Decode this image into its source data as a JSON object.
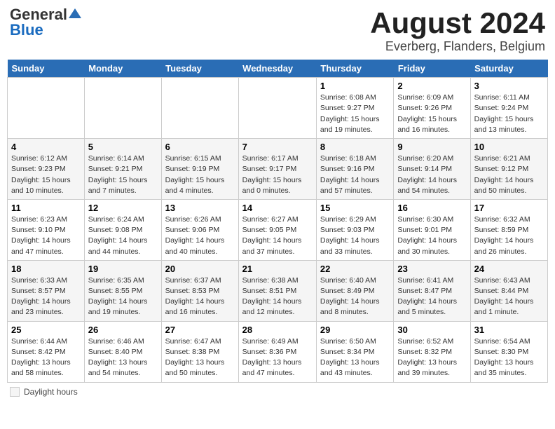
{
  "header": {
    "logo_general": "General",
    "logo_blue": "Blue",
    "title": "August 2024",
    "location": "Everberg, Flanders, Belgium"
  },
  "calendar": {
    "days_of_week": [
      "Sunday",
      "Monday",
      "Tuesday",
      "Wednesday",
      "Thursday",
      "Friday",
      "Saturday"
    ],
    "weeks": [
      [
        {
          "day": "",
          "info": ""
        },
        {
          "day": "",
          "info": ""
        },
        {
          "day": "",
          "info": ""
        },
        {
          "day": "",
          "info": ""
        },
        {
          "day": "1",
          "info": "Sunrise: 6:08 AM\nSunset: 9:27 PM\nDaylight: 15 hours\nand 19 minutes."
        },
        {
          "day": "2",
          "info": "Sunrise: 6:09 AM\nSunset: 9:26 PM\nDaylight: 15 hours\nand 16 minutes."
        },
        {
          "day": "3",
          "info": "Sunrise: 6:11 AM\nSunset: 9:24 PM\nDaylight: 15 hours\nand 13 minutes."
        }
      ],
      [
        {
          "day": "4",
          "info": "Sunrise: 6:12 AM\nSunset: 9:23 PM\nDaylight: 15 hours\nand 10 minutes."
        },
        {
          "day": "5",
          "info": "Sunrise: 6:14 AM\nSunset: 9:21 PM\nDaylight: 15 hours\nand 7 minutes."
        },
        {
          "day": "6",
          "info": "Sunrise: 6:15 AM\nSunset: 9:19 PM\nDaylight: 15 hours\nand 4 minutes."
        },
        {
          "day": "7",
          "info": "Sunrise: 6:17 AM\nSunset: 9:17 PM\nDaylight: 15 hours\nand 0 minutes."
        },
        {
          "day": "8",
          "info": "Sunrise: 6:18 AM\nSunset: 9:16 PM\nDaylight: 14 hours\nand 57 minutes."
        },
        {
          "day": "9",
          "info": "Sunrise: 6:20 AM\nSunset: 9:14 PM\nDaylight: 14 hours\nand 54 minutes."
        },
        {
          "day": "10",
          "info": "Sunrise: 6:21 AM\nSunset: 9:12 PM\nDaylight: 14 hours\nand 50 minutes."
        }
      ],
      [
        {
          "day": "11",
          "info": "Sunrise: 6:23 AM\nSunset: 9:10 PM\nDaylight: 14 hours\nand 47 minutes."
        },
        {
          "day": "12",
          "info": "Sunrise: 6:24 AM\nSunset: 9:08 PM\nDaylight: 14 hours\nand 44 minutes."
        },
        {
          "day": "13",
          "info": "Sunrise: 6:26 AM\nSunset: 9:06 PM\nDaylight: 14 hours\nand 40 minutes."
        },
        {
          "day": "14",
          "info": "Sunrise: 6:27 AM\nSunset: 9:05 PM\nDaylight: 14 hours\nand 37 minutes."
        },
        {
          "day": "15",
          "info": "Sunrise: 6:29 AM\nSunset: 9:03 PM\nDaylight: 14 hours\nand 33 minutes."
        },
        {
          "day": "16",
          "info": "Sunrise: 6:30 AM\nSunset: 9:01 PM\nDaylight: 14 hours\nand 30 minutes."
        },
        {
          "day": "17",
          "info": "Sunrise: 6:32 AM\nSunset: 8:59 PM\nDaylight: 14 hours\nand 26 minutes."
        }
      ],
      [
        {
          "day": "18",
          "info": "Sunrise: 6:33 AM\nSunset: 8:57 PM\nDaylight: 14 hours\nand 23 minutes."
        },
        {
          "day": "19",
          "info": "Sunrise: 6:35 AM\nSunset: 8:55 PM\nDaylight: 14 hours\nand 19 minutes."
        },
        {
          "day": "20",
          "info": "Sunrise: 6:37 AM\nSunset: 8:53 PM\nDaylight: 14 hours\nand 16 minutes."
        },
        {
          "day": "21",
          "info": "Sunrise: 6:38 AM\nSunset: 8:51 PM\nDaylight: 14 hours\nand 12 minutes."
        },
        {
          "day": "22",
          "info": "Sunrise: 6:40 AM\nSunset: 8:49 PM\nDaylight: 14 hours\nand 8 minutes."
        },
        {
          "day": "23",
          "info": "Sunrise: 6:41 AM\nSunset: 8:47 PM\nDaylight: 14 hours\nand 5 minutes."
        },
        {
          "day": "24",
          "info": "Sunrise: 6:43 AM\nSunset: 8:44 PM\nDaylight: 14 hours\nand 1 minute."
        }
      ],
      [
        {
          "day": "25",
          "info": "Sunrise: 6:44 AM\nSunset: 8:42 PM\nDaylight: 13 hours\nand 58 minutes."
        },
        {
          "day": "26",
          "info": "Sunrise: 6:46 AM\nSunset: 8:40 PM\nDaylight: 13 hours\nand 54 minutes."
        },
        {
          "day": "27",
          "info": "Sunrise: 6:47 AM\nSunset: 8:38 PM\nDaylight: 13 hours\nand 50 minutes."
        },
        {
          "day": "28",
          "info": "Sunrise: 6:49 AM\nSunset: 8:36 PM\nDaylight: 13 hours\nand 47 minutes."
        },
        {
          "day": "29",
          "info": "Sunrise: 6:50 AM\nSunset: 8:34 PM\nDaylight: 13 hours\nand 43 minutes."
        },
        {
          "day": "30",
          "info": "Sunrise: 6:52 AM\nSunset: 8:32 PM\nDaylight: 13 hours\nand 39 minutes."
        },
        {
          "day": "31",
          "info": "Sunrise: 6:54 AM\nSunset: 8:30 PM\nDaylight: 13 hours\nand 35 minutes."
        }
      ]
    ]
  },
  "legend": {
    "text": "Daylight hours"
  }
}
